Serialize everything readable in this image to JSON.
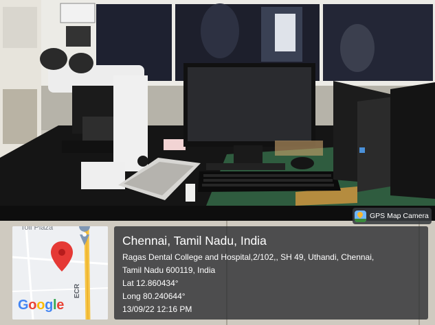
{
  "photo": {
    "subject": "Microscope, monitor, keyboard and desktop computer on a black laboratory bench"
  },
  "badge": {
    "label": "GPS Map Camera",
    "icon": "gps-map-camera-icon"
  },
  "map": {
    "area_label": "Toll Plaza",
    "road_label": "ECR",
    "provider_logo": [
      "G",
      "o",
      "o",
      "g",
      "l",
      "e"
    ],
    "logo_colors": [
      "#4285F4",
      "#EA4335",
      "#FBBC05",
      "#4285F4",
      "#34A853",
      "#EA4335"
    ],
    "pin_color": "#e53935"
  },
  "location": {
    "city": "Chennai, Tamil Nadu, India",
    "address_line1": "Ragas Dental College and Hospital,2/102,, SH 49, Uthandi, Chennai,",
    "address_line2": "Tamil Nadu 600119, India",
    "latitude": "Lat 12.860434°",
    "longitude": "Long 80.240644°",
    "timestamp": "13/09/22 12:16 PM"
  }
}
